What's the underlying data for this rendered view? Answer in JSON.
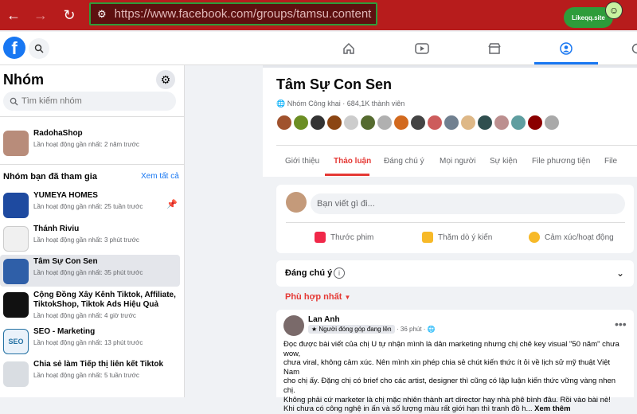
{
  "browser": {
    "url_prefix": "https://www.facebook.com",
    "url_path": "/groups/tamsu.content",
    "extension_label": "Likeqq.site"
  },
  "sidebar": {
    "title": "Nhóm",
    "search_placeholder": "Tìm kiếm nhóm",
    "owned_group": {
      "name": "RadohaShop",
      "activity": "Lần hoạt động gần nhất: 2 năm trước"
    },
    "section_title": "Nhóm bạn đã tham gia",
    "see_all": "Xem tất cả",
    "groups": [
      {
        "name": "YUMEYA HOMES",
        "activity": "Lần hoạt động gần nhất: 25 tuần trước",
        "color": "#1e4aa0"
      },
      {
        "name": "Thánh Riviu",
        "activity": "Lần hoạt động gần nhất: 3 phút trước",
        "color": "#c0392b"
      },
      {
        "name": "Tâm Sự Con Sen",
        "activity": "Lần hoạt động gần nhất: 35 phút trước",
        "color": "#2f5fa8"
      },
      {
        "name": "Cộng Đồng Xây Kênh Tiktok, Affiliate, TiktokShop, Tiktok Ads Hiệu Quả",
        "activity": "Lần hoạt động gần nhất: 4 giờ trước",
        "color": "#111111"
      },
      {
        "name": "SEO - Marketing",
        "activity": "Lần hoạt động gần nhất: 13 phút trước",
        "color": "#2471a3"
      },
      {
        "name": "Chia sẻ làm Tiếp thị liên kết Tiktok",
        "activity": "Lần hoạt động gần nhất: 5 tuần trước",
        "color": "#9aa1a9"
      }
    ]
  },
  "group": {
    "title": "Tâm Sự Con Sen",
    "meta": "Nhóm Công khai · 684,1K thành viên",
    "tabs": [
      "Giới thiệu",
      "Thảo luận",
      "Đáng chú ý",
      "Mọi người",
      "Sự kiện",
      "File phương tiện",
      "File"
    ],
    "active_tab": "Thảo luận"
  },
  "composer": {
    "placeholder": "Bạn viết gì đi...",
    "actions": [
      "Thước phim",
      "Thăm dò ý kiến",
      "Cảm xúc/hoạt động"
    ]
  },
  "featured": {
    "title": "Đáng chú ý"
  },
  "sort": {
    "label": "Phù hợp nhất"
  },
  "post": {
    "author": "Lan Anh",
    "badge": "Người đóng góp đang lên",
    "time": "· 36 phút ·",
    "lines": [
      "Đọc được bài viết của chị U tự nhận mình là dân marketing nhưng chị chê key visual \"50 năm\" chưa wow,",
      "chưa viral, không cảm xúc. Nên mình xin phép chia sẻ chút kiến thức ít ỏi về lịch sử mỹ thuật Việt Nam",
      "cho chị ấy. Đặng chị có brief cho các artist, designer thì cũng có lập luận kiến thức vững vàng nhen chị.",
      "Không phải cứ marketer là chị mặc nhiên thành art director hay nhà phê bình đâu. Rồi vào bài nè!",
      "Khi chưa có công nghệ in ấn và số lượng màu rất giới hạn thì tranh đồ h..."
    ],
    "see_more": "Xem thêm"
  },
  "colors": {
    "accent": "#1877f2",
    "active_tab": "#e53935",
    "browser": "#b71c1c"
  }
}
